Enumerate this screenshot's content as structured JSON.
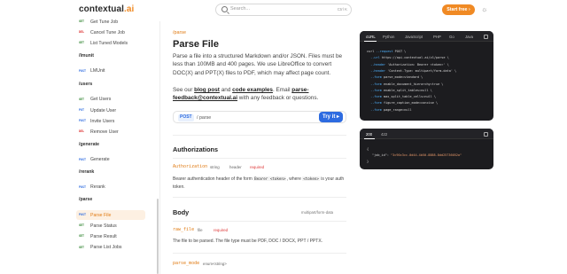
{
  "header": {
    "logo_text": "contextual",
    "logo_suffix": ".ai",
    "search_placeholder": "Search...",
    "search_shortcut": "Ctrl K",
    "start_button": "Start free",
    "start_arrow": "›",
    "theme_icon": "sun-icon",
    "theme_glyph": "☼"
  },
  "sidebar": {
    "items_top": [
      {
        "method": "GET",
        "label": "Get Tune Job"
      },
      {
        "method": "DEL",
        "label": "Cancel Tune Job"
      },
      {
        "method": "GET",
        "label": "List Tuned Models"
      }
    ],
    "groups": [
      {
        "title": "/lmunit",
        "items": [
          {
            "method": "POST",
            "label": "LMUnit"
          }
        ]
      },
      {
        "title": "/users",
        "items": [
          {
            "method": "GET",
            "label": "Get Users"
          },
          {
            "method": "PUT",
            "label": "Update User"
          },
          {
            "method": "POST",
            "label": "Invite Users"
          },
          {
            "method": "DEL",
            "label": "Remove User"
          }
        ]
      },
      {
        "title": "/generate",
        "items": [
          {
            "method": "POST",
            "label": "Generate"
          }
        ]
      },
      {
        "title": "/rerank",
        "items": [
          {
            "method": "POST",
            "label": "Rerank"
          }
        ]
      },
      {
        "title": "/parse",
        "items": [
          {
            "method": "POST",
            "label": "Parse File",
            "active": true
          },
          {
            "method": "GET",
            "label": "Parse Status"
          },
          {
            "method": "GET",
            "label": "Parse Result"
          },
          {
            "method": "GET",
            "label": "Parse List Jobs"
          }
        ]
      }
    ]
  },
  "main": {
    "breadcrumb": "/parse",
    "title": "Parse File",
    "description": "Parse a file into a structured Markdown and/or JSON. Files must be less than 100MB and 400 pages. We use LibreOffice to convert DOC(X) and PPT(X) files to PDF, which may affect page count.",
    "see_prefix": "See our ",
    "see_blog": "blog post",
    "see_and": " and ",
    "see_code": "code examples",
    "see_email_prefix": ". Email ",
    "see_email": "parse-feedback@contextual.ai",
    "see_suffix": " with any feedback or questions.",
    "endpoint_method": "POST",
    "endpoint_path": "/ parse",
    "try_button": "Try it",
    "try_arrow": "▸",
    "authorizations_title": "Authorizations",
    "auth_param": "Authorization",
    "auth_type": "string",
    "auth_loc": "header",
    "auth_required": "required",
    "auth_desc_1": "Bearer authentication header of the form ",
    "auth_code_1": "Bearer <token>",
    "auth_desc_2": ", where ",
    "auth_code_2": "<token>",
    "auth_desc_3": " is your auth token.",
    "body_title": "Body",
    "body_type": "multipart/form-data",
    "raw_file_param": "raw_file",
    "raw_file_type": "file",
    "raw_file_required": "required",
    "raw_file_desc": "The file to be parsed. The file type must be PDF, DOC / DOCX, PPT / PPTX.",
    "parse_mode_param": "parse_mode",
    "parse_mode_type": "enum<string>"
  },
  "request_panel": {
    "tabs": [
      "cURL",
      "Python",
      "JavaScript",
      "PHP",
      "Go",
      "Java"
    ],
    "active_tab": "cURL",
    "lines": [
      {
        "a": "curl ",
        "f": "--request",
        "b": " POST \\"
      },
      {
        "a": "  ",
        "f": "--url",
        "b": " https://api.contextual.ai/v1/parse \\"
      },
      {
        "a": "  ",
        "f": "--header",
        "b": " 'Authorization: Bearer <token>' \\"
      },
      {
        "a": "  ",
        "f": "--header",
        "b": " 'Content-Type: multipart/form-data' \\"
      },
      {
        "a": "  ",
        "f": "--form",
        "b": " parse_mode=standard \\"
      },
      {
        "a": "  ",
        "f": "--form",
        "b": " enable_document_hierarchy=true \\"
      },
      {
        "a": "  ",
        "f": "--form",
        "b": " enable_split_tables=null \\"
      },
      {
        "a": "  ",
        "f": "--form",
        "b": " max_split_table_cells=null \\"
      },
      {
        "a": "  ",
        "f": "--form",
        "b": " figure_caption_mode=concise \\"
      },
      {
        "a": "  ",
        "f": "--form",
        "b": " page_range=null"
      }
    ]
  },
  "response_panel": {
    "tabs": [
      "200",
      "422"
    ],
    "active_tab": "200",
    "open_brace": "{",
    "key": "\"job_id\"",
    "colon": ": ",
    "value": "\"3c90c3cc-0d44-4b50-8888-8dd25736052a\"",
    "close_brace": "}"
  },
  "colors": {
    "accent": "#f08a24",
    "primary": "#2d6be0",
    "code_bg": "#1c1c1f"
  }
}
